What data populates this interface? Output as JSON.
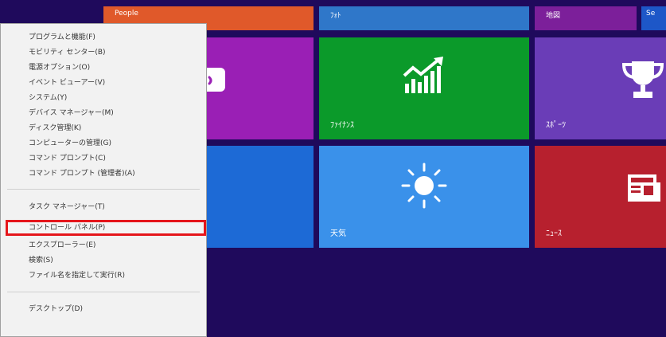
{
  "tiles": {
    "people": {
      "label": "People",
      "color": "#e0592a"
    },
    "photo": {
      "label": "ﾌｫﾄ",
      "color": "#2f77c9"
    },
    "map": {
      "label": "地図",
      "color": "#7c1f9a"
    },
    "se": {
      "label": "Se",
      "color": "#1d57c8"
    },
    "messaging": {
      "label": "",
      "color": "#9a1fb5"
    },
    "finance": {
      "label": "ﾌｧｲﾅﾝｽ",
      "color": "#0b9a2a"
    },
    "sports": {
      "label": "ｽﾎﾟｰﾂ",
      "color": "#6a3db7"
    },
    "blue_tile": {
      "label": "",
      "color": "#1d6ad6"
    },
    "weather": {
      "label": "天気",
      "color": "#3a91ea"
    },
    "news": {
      "label": "ﾆｭｰｽ",
      "color": "#b7202e"
    }
  },
  "menu": {
    "items": [
      "プログラムと機能(F)",
      "モビリティ センター(B)",
      "電源オプション(O)",
      "イベント ビューアー(V)",
      "システム(Y)",
      "デバイス マネージャー(M)",
      "ディスク管理(K)",
      "コンピューターの管理(G)",
      "コマンド プロンプト(C)",
      "コマンド プロンプト (管理者)(A)",
      "タスク マネージャー(T)",
      "コントロール パネル(P)",
      "エクスプローラー(E)",
      "検索(S)",
      "ファイル名を指定して実行(R)",
      "デスクトップ(D)"
    ],
    "highlighted_item": "コントロール パネル(P)",
    "highlight_color": "#e5161b"
  }
}
